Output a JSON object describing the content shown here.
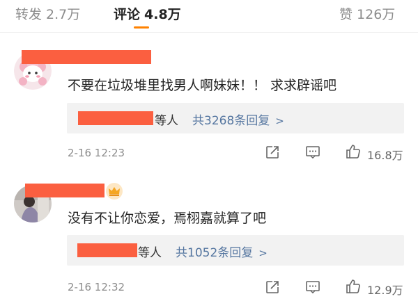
{
  "tabs": {
    "repost": {
      "label": "转发",
      "count": "2.7万"
    },
    "comments": {
      "label": "评论",
      "count": "4.8万"
    },
    "likes": {
      "label": "赞",
      "count": "126万"
    }
  },
  "colors": {
    "accent": "#ff8200",
    "link": "#5576a0",
    "redaction": "#fb5f40",
    "reply_bg": "#f2f2f2"
  },
  "comments": [
    {
      "text": "不要在垃圾堆里找男人啊妹妹！！ 求求辟谣吧",
      "reply_suffix": "等人",
      "reply_count": "共3268条回复",
      "time": "2-16 12:23",
      "likes": "16.8万",
      "avatar_icon": "pink-sheep-avatar"
    },
    {
      "text": "没有不让你恋爱，焉栩嘉就算了吧",
      "reply_suffix": "等人",
      "reply_count": "共1052条回复",
      "time": "2-16 12:32",
      "likes": "12.9万",
      "avatar_icon": "user-photo-avatar",
      "badge_icon": "crown-icon"
    }
  ]
}
